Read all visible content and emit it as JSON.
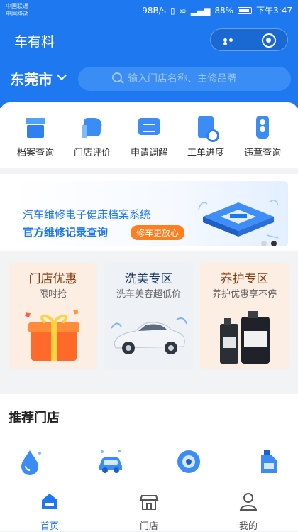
{
  "status_bar": {
    "carrier_1": "中国联通",
    "carrier_2": "中国移动",
    "net_speed": "98B/s",
    "battery": "88%",
    "time": "下午3:47"
  },
  "app": {
    "title": "车有料"
  },
  "search": {
    "city": "东莞市",
    "placeholder": "输入门店名称、主修品牌"
  },
  "quick_actions": [
    {
      "label": "档案查询",
      "icon": "archive-icon"
    },
    {
      "label": "门店评价",
      "icon": "thumbs-up-icon"
    },
    {
      "label": "申请调解",
      "icon": "message-icon"
    },
    {
      "label": "工单进度",
      "icon": "work-order-icon"
    },
    {
      "label": "违章查询",
      "icon": "traffic-light-icon"
    }
  ],
  "banner": {
    "line1": "汽车维修电子健康档案系统",
    "line2": "官方维修记录查询",
    "tag": "修车更放心",
    "carousel_current_index": 1,
    "carousel_count": 2
  },
  "promos": [
    {
      "title": "门店优惠",
      "subtitle": "限时抢",
      "title_color": "#8a3c10",
      "bg": "#fdeee4"
    },
    {
      "title": "洗美专区",
      "subtitle": "洗车美容超低价",
      "title_color": "#1f3a66",
      "bg": "#eef1f6"
    },
    {
      "title": "养护专区",
      "subtitle": "养护优惠享不停",
      "title_color": "#8a3c10",
      "bg": "#fdeee4"
    }
  ],
  "recommend": {
    "title": "推荐门店",
    "items": [
      {
        "icon": "water-drop-icon"
      },
      {
        "icon": "car-wash-icon"
      },
      {
        "icon": "tire-icon"
      },
      {
        "icon": "oil-can-icon"
      }
    ]
  },
  "tabbar": [
    {
      "label": "首页",
      "icon": "home-icon",
      "active": true
    },
    {
      "label": "门店",
      "icon": "store-icon",
      "active": false
    },
    {
      "label": "我的",
      "icon": "profile-icon",
      "active": false
    }
  ],
  "colors": {
    "primary": "#1e78f0",
    "accent_orange": "#ff7f1e",
    "tab_inactive": "#555555"
  }
}
